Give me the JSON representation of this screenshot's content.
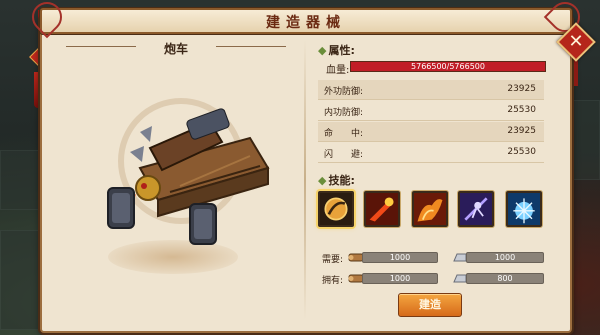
{
  "title": "建造器械",
  "close_label": "✕",
  "unit": {
    "name": "炮车"
  },
  "attributes": {
    "heading": "属性:",
    "hp_label": "血量:",
    "hp_text": "5766500/5766500",
    "hp_fraction": 1.0,
    "stats": [
      {
        "label": "外功防御:",
        "value": "23925"
      },
      {
        "label": "内功防御:",
        "value": "25530"
      },
      {
        "label": "命　　中:",
        "value": "23925"
      },
      {
        "label": "闪　　避:",
        "value": "25530"
      }
    ]
  },
  "skills": {
    "heading": "技能:",
    "items": [
      {
        "icon": "shield-slash-icon",
        "selected": true
      },
      {
        "icon": "fire-strike-icon",
        "selected": false
      },
      {
        "icon": "flame-wave-icon",
        "selected": false
      },
      {
        "icon": "shadow-dash-icon",
        "selected": false
      },
      {
        "icon": "ice-burst-icon",
        "selected": false
      }
    ]
  },
  "resources": {
    "need_label": "需要:",
    "have_label": "拥有:",
    "need": {
      "wood": "1000",
      "iron": "1000"
    },
    "have": {
      "wood": "1000",
      "iron": "800"
    }
  },
  "build_label": "建造",
  "colors": {
    "hp": "#c11e27",
    "accent": "#d66a1a",
    "frame": "#9c6e3f"
  }
}
